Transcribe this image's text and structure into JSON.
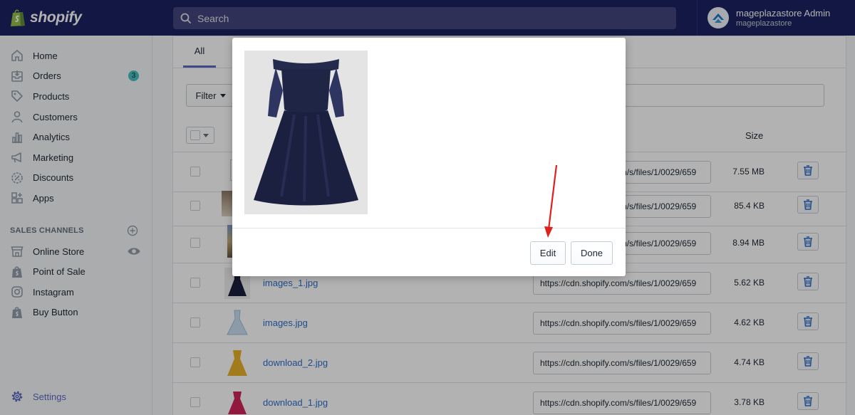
{
  "app": {
    "brand": "shopify"
  },
  "search": {
    "placeholder": "Search"
  },
  "user": {
    "name": "mageplazastore Admin",
    "store": "mageplazastore"
  },
  "sidebar": {
    "items": [
      {
        "label": "Home",
        "icon": "home-icon"
      },
      {
        "label": "Orders",
        "icon": "orders-icon",
        "badge": "3"
      },
      {
        "label": "Products",
        "icon": "tag-icon"
      },
      {
        "label": "Customers",
        "icon": "person-icon"
      },
      {
        "label": "Analytics",
        "icon": "bar-chart-icon"
      },
      {
        "label": "Marketing",
        "icon": "megaphone-icon"
      },
      {
        "label": "Discounts",
        "icon": "discount-icon"
      },
      {
        "label": "Apps",
        "icon": "apps-icon"
      }
    ],
    "sales_channels_title": "SALES CHANNELS",
    "channels": [
      {
        "label": "Online Store",
        "icon": "store-icon"
      },
      {
        "label": "Point of Sale",
        "icon": "bag-icon"
      },
      {
        "label": "Instagram",
        "icon": "instagram-icon"
      },
      {
        "label": "Buy Button",
        "icon": "bag-icon"
      }
    ],
    "settings": "Settings"
  },
  "files": {
    "tab_all": "All",
    "filter_label": "Filter",
    "size_header": "Size",
    "rows": [
      {
        "name": "",
        "url": "https://cdn.shopify.com/s/files/1/0029/659",
        "size": "7.55 MB"
      },
      {
        "name": "",
        "url": "https://cdn.shopify.com/s/files/1/0029/659",
        "size": "85.4 KB"
      },
      {
        "name": "",
        "url": "https://cdn.shopify.com/s/files/1/0029/659",
        "size": "8.94 MB"
      },
      {
        "name": "images_1.jpg",
        "url": "https://cdn.shopify.com/s/files/1/0029/659",
        "size": "5.62 KB"
      },
      {
        "name": "images.jpg",
        "url": "https://cdn.shopify.com/s/files/1/0029/659",
        "size": "4.62 KB"
      },
      {
        "name": "download_2.jpg",
        "url": "https://cdn.shopify.com/s/files/1/0029/659",
        "size": "4.74 KB"
      },
      {
        "name": "download_1.jpg",
        "url": "https://cdn.shopify.com/s/files/1/0029/659",
        "size": "3.78 KB"
      }
    ]
  },
  "modal": {
    "edit_label": "Edit",
    "done_label": "Done"
  },
  "colors": {
    "topbar": "#1c2260",
    "accent": "#5c6ac4",
    "link": "#2c6ecb",
    "annotation": "#e0201c"
  }
}
